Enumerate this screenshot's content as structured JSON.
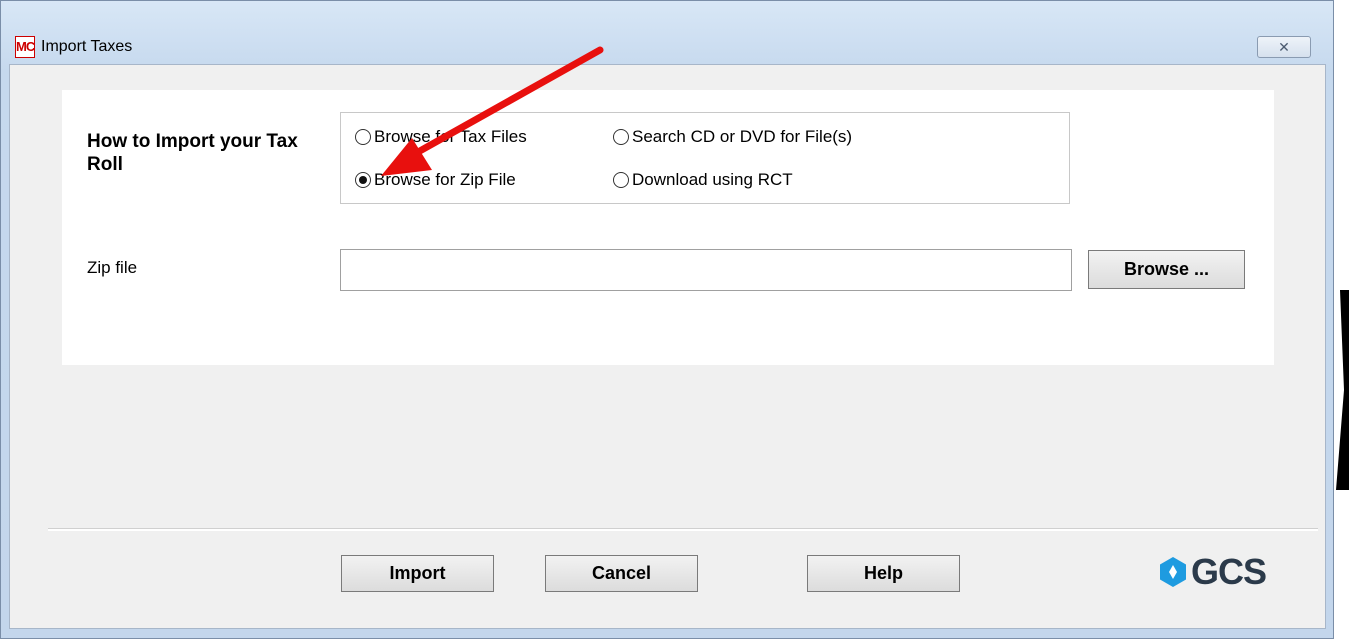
{
  "window": {
    "icon_text": "MC",
    "title": "Import Taxes",
    "close_glyph": "✕"
  },
  "import_section": {
    "label": "How to Import your Tax Roll",
    "options": [
      {
        "label": "Browse for Tax Files",
        "selected": false
      },
      {
        "label": "Search CD or DVD for File(s)",
        "selected": false
      },
      {
        "label": "Browse for Zip File",
        "selected": true
      },
      {
        "label": "Download using RCT",
        "selected": false
      }
    ]
  },
  "zip_file": {
    "label": "Zip file",
    "value": "",
    "browse_label": "Browse ..."
  },
  "footer": {
    "import_label": "Import",
    "cancel_label": "Cancel",
    "help_label": "Help",
    "logo_text": "GCS"
  },
  "colors": {
    "arrow": "#e8100e",
    "logo_mark": "#1e9be0",
    "logo_text": "#2b3a4a"
  }
}
